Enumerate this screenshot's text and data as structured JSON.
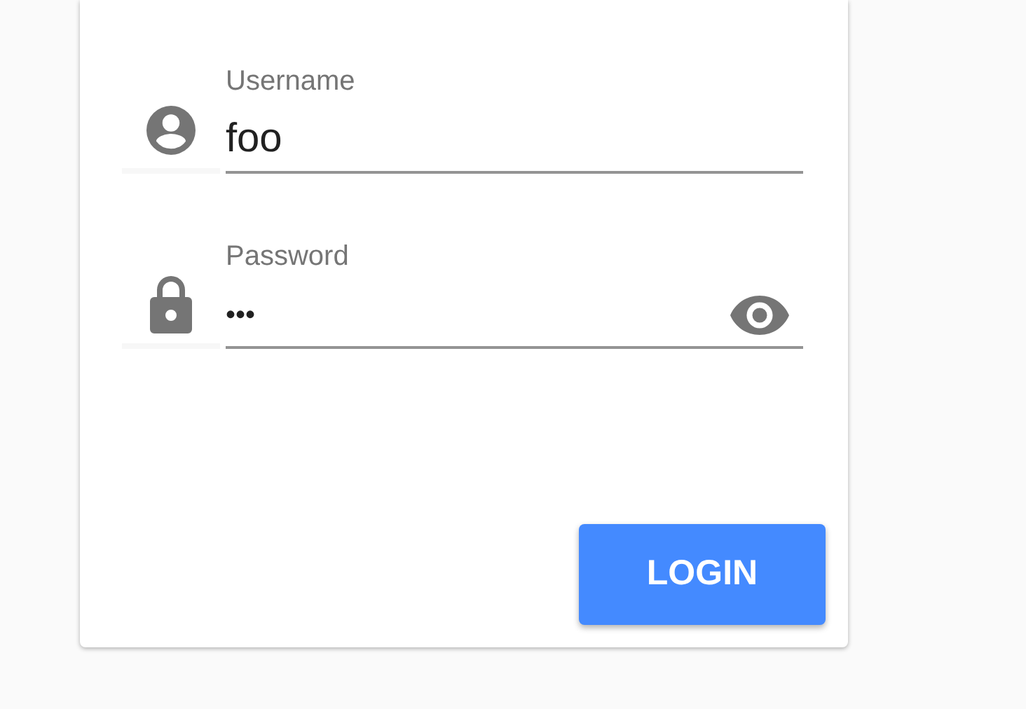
{
  "fields": [
    {
      "kind": "username",
      "label": "Username",
      "value": "foo"
    },
    {
      "kind": "password",
      "label": "Password",
      "value": "•••"
    }
  ],
  "login_button": {
    "label": "LOGIN"
  }
}
